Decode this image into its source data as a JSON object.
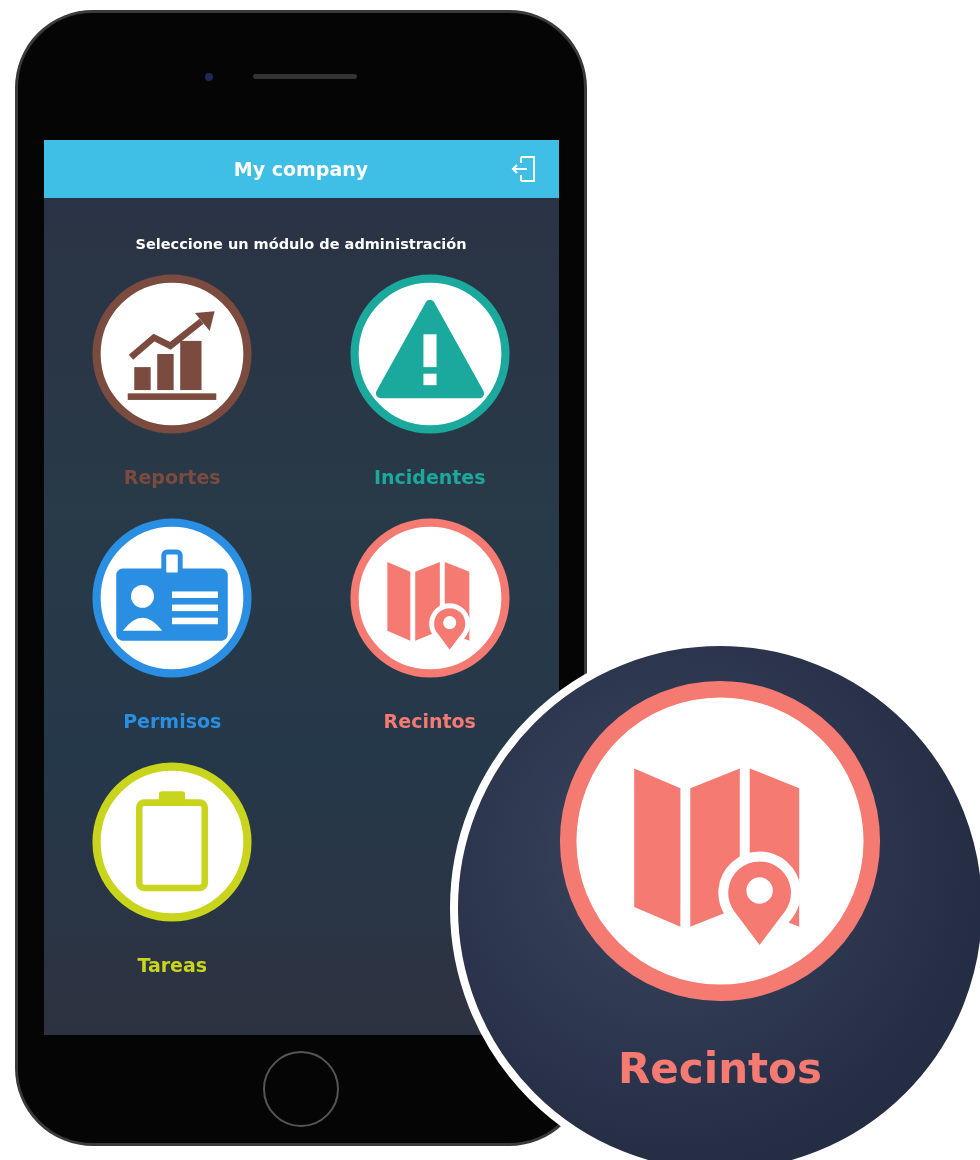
{
  "header": {
    "title": "My company"
  },
  "subtitle": "Seleccione un módulo de administración",
  "modules": [
    {
      "label": "Reportes",
      "kind": "chart",
      "color": "#7a4b3e"
    },
    {
      "label": "Incidentes",
      "kind": "warning",
      "color": "#1aa99c"
    },
    {
      "label": "Permisos",
      "kind": "badge",
      "color": "#2a8fe2"
    },
    {
      "label": "Recintos",
      "kind": "map",
      "color": "#f47a72"
    },
    {
      "label": "Tareas",
      "kind": "clipboard",
      "color": "#c9d41c"
    }
  ],
  "magnifier": {
    "label": "Recintos",
    "kind": "map",
    "color": "#f47a72"
  }
}
